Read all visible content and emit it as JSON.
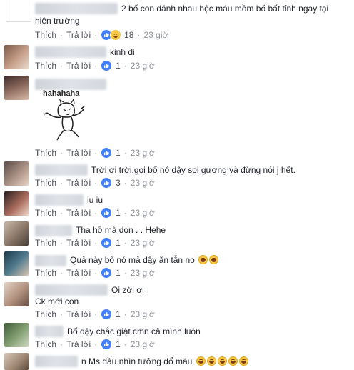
{
  "colors": {
    "like": "#4080ff",
    "text": "#1d2129",
    "meta": "#4b4f56",
    "time": "#90949c"
  },
  "labels": {
    "like": "Thích",
    "reply": "Trả lời",
    "separator": "·"
  },
  "comments": [
    {
      "text": "2 bố con đánh nhau hộc máu mồm bố bất tỉnh ngay tại",
      "text2": "hiện trường",
      "count": "18",
      "time": "23 giờ",
      "reactions": "like-haha"
    },
    {
      "text": "kinh dị",
      "count": "1",
      "time": "23 giờ",
      "reactions": "like"
    },
    {
      "sticker": "hahahaha",
      "count": "1",
      "time": "23 giờ",
      "reactions": "like"
    },
    {
      "text": "Trời ơi trời.gọi bố nó dậy soi gương và đừng nói j hết.",
      "count": "3",
      "time": "23 giờ",
      "reactions": "like"
    },
    {
      "text": "iu iu",
      "count": "1",
      "time": "23 giờ",
      "reactions": "like"
    },
    {
      "text": "Tha hồ mà dọn . . Hehe",
      "count": "1",
      "time": "23 giờ",
      "reactions": "like"
    },
    {
      "text": "Quả này bố nó mả dậy ăn tẫn no",
      "count": "1",
      "time": "23 giờ",
      "reactions": "like"
    },
    {
      "text": "Oi zời ơi",
      "text2": "Ck mới con",
      "count": "1",
      "time": "23 giờ",
      "reactions": "like"
    },
    {
      "text": "Bố dậy chắc giật cmn cả mình luôn",
      "count": "1",
      "time": "23 giờ",
      "reactions": "like"
    },
    {
      "text": "n Ms đầu nhìn tưởng đổ máu"
    }
  ]
}
